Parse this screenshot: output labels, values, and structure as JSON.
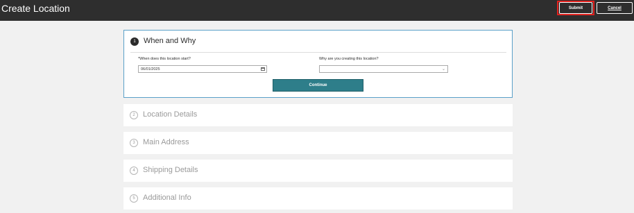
{
  "header": {
    "title": "Create Location",
    "submit_label": "Submit",
    "cancel_label": "Cancel"
  },
  "steps": [
    {
      "number": "1",
      "title": "When and Why",
      "active": true,
      "fields": {
        "start_label": "When does this location start?",
        "start_required_mark": "*",
        "start_value": "06/01/2025",
        "reason_label": "Why are you creating this location?",
        "reason_value": ""
      },
      "continue_label": "Continue"
    },
    {
      "number": "2",
      "title": "Location Details",
      "active": false
    },
    {
      "number": "3",
      "title": "Main Address",
      "active": false
    },
    {
      "number": "4",
      "title": "Shipping Details",
      "active": false
    },
    {
      "number": "5",
      "title": "Additional Info",
      "active": false
    }
  ]
}
